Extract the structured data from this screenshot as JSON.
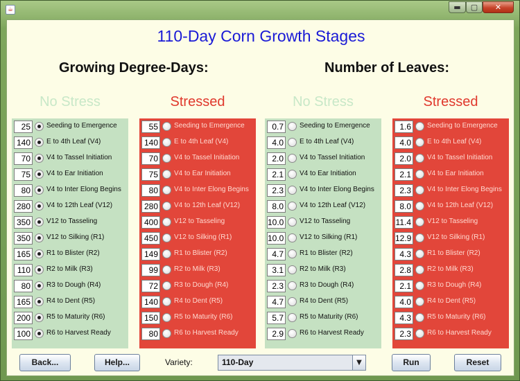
{
  "window": {
    "app_icon": "java-icon",
    "min_glyph": "▬",
    "max_glyph": "▢",
    "close_glyph": "✕"
  },
  "title": "110-Day Corn Growth Stages",
  "sections": {
    "gdd": "Growing Degree-Days:",
    "leaves": "Number of Leaves:"
  },
  "column_headers": {
    "no_stress": "No Stress",
    "stressed": "Stressed",
    "no_stress_color": "#c5e1c2",
    "stressed_color": "#e2463a",
    "no_stress_text_color": "#c8e8c8",
    "stressed_text_color": "#e0382c"
  },
  "stages": [
    "Seeding to Emergence",
    "E to 4th Leaf (V4)",
    "V4 to Tassel Initiation",
    "V4 to Ear Initiation",
    "V4 to Inter Elong Begins",
    "V4 to 12th Leaf (V12)",
    "V12 to Tasseling",
    "V12 to Silking (R1)",
    "R1 to Blister (R2)",
    "R2 to Milk (R3)",
    "R3 to Dough (R4)",
    "R4 to Dent (R5)",
    "R5 to Maturity (R6)",
    "R6 to Harvest Ready"
  ],
  "columns": {
    "gdd_no_stress": {
      "values": [
        "25",
        "140",
        "70",
        "75",
        "80",
        "280",
        "350",
        "350",
        "165",
        "110",
        "80",
        "165",
        "200",
        "100"
      ],
      "selected": true
    },
    "gdd_stressed": {
      "values": [
        "55",
        "140",
        "70",
        "75",
        "80",
        "280",
        "400",
        "450",
        "149",
        "99",
        "72",
        "140",
        "150",
        "80"
      ],
      "selected": false
    },
    "leaves_no_stress": {
      "values": [
        "0.7",
        "4.0",
        "2.0",
        "2.1",
        "2.3",
        "8.0",
        "10.0",
        "10.0",
        "4.7",
        "3.1",
        "2.3",
        "4.7",
        "5.7",
        "2.9"
      ],
      "selected": false
    },
    "leaves_stressed": {
      "values": [
        "1.6",
        "4.0",
        "2.0",
        "2.1",
        "2.3",
        "8.0",
        "11.4",
        "12.9",
        "4.3",
        "2.8",
        "2.1",
        "4.0",
        "4.3",
        "2.3"
      ],
      "selected": false
    }
  },
  "buttons": {
    "back": "Back...",
    "help": "Help...",
    "run": "Run",
    "reset": "Reset"
  },
  "variety": {
    "label": "Variety:",
    "value": "110-Day",
    "arrow_glyph": "▼"
  }
}
